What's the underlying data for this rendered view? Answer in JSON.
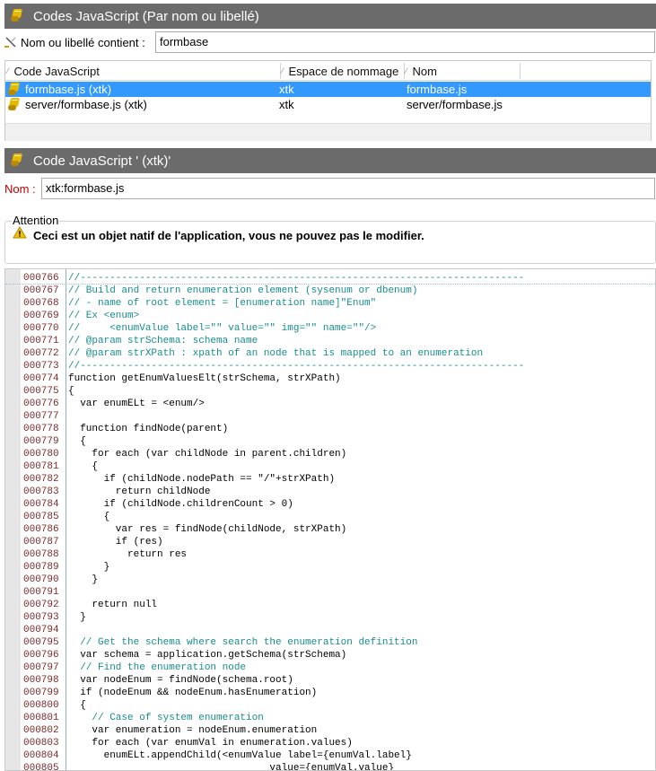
{
  "list_panel": {
    "title": "Codes JavaScript (Par nom ou libellé)"
  },
  "filter": {
    "label": "Nom ou libellé contient :",
    "value": "formbase"
  },
  "grid": {
    "columns": [
      "Code JavaScript",
      "Espace de nommage",
      "Nom"
    ],
    "rows": [
      {
        "code": "formbase.js (xtk)",
        "namespace": "xtk",
        "name": "formbase.js",
        "selected": true
      },
      {
        "code": "server/formbase.js (xtk)",
        "namespace": "xtk",
        "name": "server/formbase.js",
        "selected": false
      }
    ]
  },
  "detail_panel": {
    "title": "Code JavaScript ' (xtk)'"
  },
  "nom": {
    "label": "Nom :",
    "value": "xtk:formbase.js"
  },
  "attention": {
    "legend": "Attention",
    "message": "Ceci est un objet natif de l'application, vous ne pouvez pas le modifier."
  },
  "code": [
    {
      "ln": "000766",
      "text": "//---------------------------------------------------------------------------",
      "comment": true
    },
    {
      "ln": "000767",
      "text": "// Build and return enumeration element (sysenum or dbenum)",
      "comment": true
    },
    {
      "ln": "000768",
      "text": "// - name of root element = [enumeration name]\"Enum\"",
      "comment": true
    },
    {
      "ln": "000769",
      "text": "// Ex <enum>",
      "comment": true
    },
    {
      "ln": "000770",
      "text": "//     <enumValue label=\"\" value=\"\" img=\"\" name=\"\"/>",
      "comment": true
    },
    {
      "ln": "000771",
      "text": "// @param strSchema: schema name",
      "comment": true
    },
    {
      "ln": "000772",
      "text": "// @param strXPath : xpath of an node that is mapped to an enumeration",
      "comment": true
    },
    {
      "ln": "000773",
      "text": "//---------------------------------------------------------------------------",
      "comment": true
    },
    {
      "ln": "000774",
      "text": "function getEnumValuesElt(strSchema, strXPath)",
      "comment": false
    },
    {
      "ln": "000775",
      "text": "{",
      "comment": false
    },
    {
      "ln": "000776",
      "text": "  var enumELt = <enum/>",
      "comment": false
    },
    {
      "ln": "000777",
      "text": "",
      "comment": false
    },
    {
      "ln": "000778",
      "text": "  function findNode(parent)",
      "comment": false
    },
    {
      "ln": "000779",
      "text": "  {",
      "comment": false
    },
    {
      "ln": "000780",
      "text": "    for each (var childNode in parent.children)",
      "comment": false
    },
    {
      "ln": "000781",
      "text": "    {",
      "comment": false
    },
    {
      "ln": "000782",
      "text": "      if (childNode.nodePath == \"/\"+strXPath)",
      "comment": false
    },
    {
      "ln": "000783",
      "text": "        return childNode",
      "comment": false
    },
    {
      "ln": "000784",
      "text": "      if (childNode.childrenCount > 0)",
      "comment": false
    },
    {
      "ln": "000785",
      "text": "      {",
      "comment": false
    },
    {
      "ln": "000786",
      "text": "        var res = findNode(childNode, strXPath)",
      "comment": false
    },
    {
      "ln": "000787",
      "text": "        if (res)",
      "comment": false
    },
    {
      "ln": "000788",
      "text": "          return res",
      "comment": false
    },
    {
      "ln": "000789",
      "text": "      }",
      "comment": false
    },
    {
      "ln": "000790",
      "text": "    }",
      "comment": false
    },
    {
      "ln": "000791",
      "text": "",
      "comment": false
    },
    {
      "ln": "000792",
      "text": "    return null",
      "comment": false
    },
    {
      "ln": "000793",
      "text": "  }",
      "comment": false
    },
    {
      "ln": "000794",
      "text": "",
      "comment": false
    },
    {
      "ln": "000795",
      "text": "  // Get the schema where search the enumeration definition",
      "comment": true
    },
    {
      "ln": "000796",
      "text": "  var schema = application.getSchema(strSchema)",
      "comment": false
    },
    {
      "ln": "000797",
      "text": "  // Find the enumeration node",
      "comment": true
    },
    {
      "ln": "000798",
      "text": "  var nodeEnum = findNode(schema.root)",
      "comment": false
    },
    {
      "ln": "000799",
      "text": "  if (nodeEnum && nodeEnum.hasEnumeration)",
      "comment": false
    },
    {
      "ln": "000800",
      "text": "  {",
      "comment": false
    },
    {
      "ln": "000801",
      "text": "    // Case of system enumeration",
      "comment": true
    },
    {
      "ln": "000802",
      "text": "    var enumeration = nodeEnum.enumeration",
      "comment": false
    },
    {
      "ln": "000803",
      "text": "    for each (var enumVal in enumeration.values)",
      "comment": false
    },
    {
      "ln": "000804",
      "text": "      enumELt.appendChild(<enumValue label={enumVal.label}",
      "comment": false
    },
    {
      "ln": "000805",
      "text": "                                  value={enumVal.value}",
      "comment": false
    }
  ]
}
